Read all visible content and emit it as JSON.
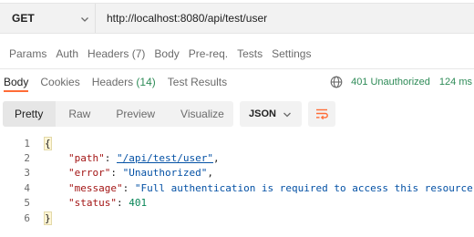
{
  "request": {
    "method": "GET",
    "url": "http://localhost:8080/api/test/user"
  },
  "request_tabs": [
    {
      "label": "Params"
    },
    {
      "label": "Auth"
    },
    {
      "label": "Headers (7)"
    },
    {
      "label": "Body"
    },
    {
      "label": "Pre-req."
    },
    {
      "label": "Tests"
    },
    {
      "label": "Settings"
    }
  ],
  "response_tabs": [
    {
      "label": "Body",
      "count": ""
    },
    {
      "label": "Cookies",
      "count": ""
    },
    {
      "label": "Headers",
      "count": "(14)"
    },
    {
      "label": "Test Results",
      "count": ""
    }
  ],
  "status": {
    "text": "401 Unauthorized",
    "time": "124 ms",
    "color": "#2e8b57",
    "icon": "globe-icon"
  },
  "view_modes": [
    "Pretty",
    "Raw",
    "Preview",
    "Visualize"
  ],
  "format": "JSON",
  "code_lines": [
    {
      "num": "1",
      "open": "{"
    },
    {
      "num": "2",
      "key": "\"path\"",
      "sep": ": ",
      "value": "\"/api/test/user\"",
      "tail": ","
    },
    {
      "num": "3",
      "key": "\"error\"",
      "sep": ": ",
      "value": "\"Unauthorized\"",
      "tail": ","
    },
    {
      "num": "4",
      "key": "\"message\"",
      "sep": ": ",
      "value": "\"Full authentication is required to access this resource\"",
      "tail": ","
    },
    {
      "num": "5",
      "key": "\"status\"",
      "sep": ": ",
      "value": "401",
      "tail": ""
    },
    {
      "num": "6",
      "close": "}"
    }
  ],
  "colors": {
    "accent": "#ff6c37",
    "key": "#a31515",
    "string": "#0451a5",
    "number": "#098658"
  }
}
